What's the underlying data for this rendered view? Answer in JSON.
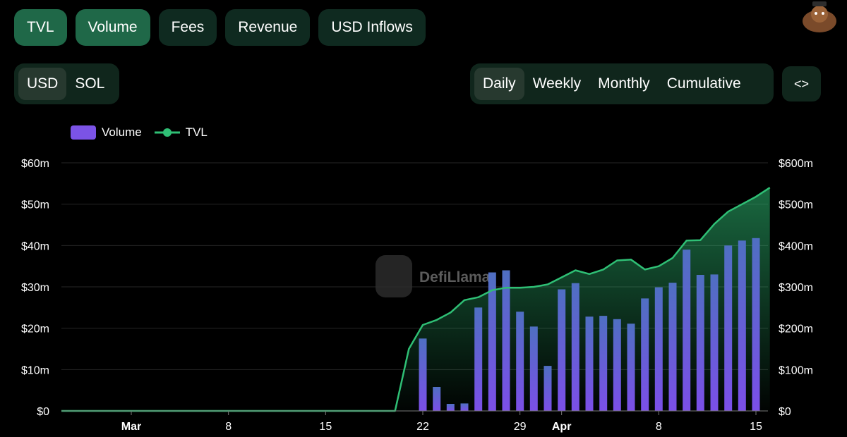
{
  "metric_tabs": [
    {
      "label": "TVL",
      "active": true
    },
    {
      "label": "Volume",
      "active": true
    },
    {
      "label": "Fees",
      "active": false
    },
    {
      "label": "Revenue",
      "active": false
    },
    {
      "label": "USD Inflows",
      "active": false
    }
  ],
  "currency_toggle": [
    {
      "label": "USD",
      "active": true
    },
    {
      "label": "SOL",
      "active": false
    }
  ],
  "period_toggle": [
    {
      "label": "Daily",
      "active": true
    },
    {
      "label": "Weekly",
      "active": false
    },
    {
      "label": "Monthly",
      "active": false
    },
    {
      "label": "Cumulative",
      "active": false
    }
  ],
  "embed_button": {
    "icon": "code-brackets-icon",
    "label": "<>"
  },
  "watermark": "DefiLlama",
  "colors": {
    "volume": "#7b53e6",
    "tvl": "#2fbf75",
    "active_pill": "#1f6848",
    "pill": "#0f2a20"
  },
  "chart_data": {
    "type": "bar",
    "legend": [
      {
        "name": "Volume",
        "kind": "bar"
      },
      {
        "name": "TVL",
        "kind": "line"
      }
    ],
    "x_ticks": [
      {
        "label": "Mar",
        "date": "Mar 1",
        "bold": true
      },
      {
        "label": "8",
        "date": "Mar 8",
        "bold": false
      },
      {
        "label": "15",
        "date": "Mar 15",
        "bold": false
      },
      {
        "label": "22",
        "date": "Mar 22",
        "bold": false
      },
      {
        "label": "29",
        "date": "Mar 29",
        "bold": false
      },
      {
        "label": "Apr",
        "date": "Apr 1",
        "bold": true
      },
      {
        "label": "8",
        "date": "Apr 8",
        "bold": false
      },
      {
        "label": "15",
        "date": "Apr 15",
        "bold": false
      }
    ],
    "y_left": {
      "ticks": [
        "$0",
        "$10m",
        "$20m",
        "$30m",
        "$40m",
        "$50m",
        "$60m"
      ],
      "range": [
        0,
        60
      ],
      "unit": "USD millions"
    },
    "y_right": {
      "ticks": [
        "$0",
        "$100m",
        "$200m",
        "$300m",
        "$400m",
        "$500m",
        "$600m"
      ],
      "range": [
        0,
        600
      ],
      "unit": "USD millions"
    },
    "grid": true,
    "series": [
      {
        "name": "Volume",
        "axis": "left",
        "points": [
          [
            "Mar 22",
            17.5
          ],
          [
            "Mar 23",
            5.8
          ],
          [
            "Mar 24",
            1.7
          ],
          [
            "Mar 25",
            1.8
          ],
          [
            "Mar 26",
            25
          ],
          [
            "Mar 27",
            33.5
          ],
          [
            "Mar 28",
            34
          ],
          [
            "Mar 29",
            24
          ],
          [
            "Mar 30",
            20.4
          ],
          [
            "Mar 31",
            10.9
          ],
          [
            "Apr 1",
            29.4
          ],
          [
            "Apr 2",
            30.9
          ],
          [
            "Apr 3",
            22.8
          ],
          [
            "Apr 4",
            23
          ],
          [
            "Apr 5",
            22.2
          ],
          [
            "Apr 6",
            21.1
          ],
          [
            "Apr 7",
            27.2
          ],
          [
            "Apr 8",
            29.9
          ],
          [
            "Apr 9",
            31
          ],
          [
            "Apr 10",
            39
          ],
          [
            "Apr 11",
            32.9
          ],
          [
            "Apr 12",
            33
          ],
          [
            "Apr 13",
            40
          ],
          [
            "Apr 14",
            41.2
          ],
          [
            "Apr 15",
            41.8
          ]
        ]
      },
      {
        "name": "TVL",
        "axis": "right",
        "points": [
          [
            "Feb 24",
            0
          ],
          [
            "Mar 20",
            0
          ],
          [
            "Mar 21",
            150
          ],
          [
            "Mar 22",
            208
          ],
          [
            "Mar 23",
            220
          ],
          [
            "Mar 24",
            238
          ],
          [
            "Mar 25",
            268
          ],
          [
            "Mar 26",
            275
          ],
          [
            "Mar 27",
            292
          ],
          [
            "Mar 28",
            298
          ],
          [
            "Mar 29",
            298
          ],
          [
            "Mar 30",
            300
          ],
          [
            "Mar 31",
            306
          ],
          [
            "Apr 1",
            323
          ],
          [
            "Apr 2",
            340
          ],
          [
            "Apr 3",
            331
          ],
          [
            "Apr 4",
            342
          ],
          [
            "Apr 5",
            364
          ],
          [
            "Apr 6",
            366
          ],
          [
            "Apr 7",
            342
          ],
          [
            "Apr 8",
            350
          ],
          [
            "Apr 9",
            370
          ],
          [
            "Apr 10",
            412
          ],
          [
            "Apr 11",
            413
          ],
          [
            "Apr 12",
            452
          ],
          [
            "Apr 13",
            482
          ],
          [
            "Apr 14",
            500
          ],
          [
            "Apr 15",
            518
          ],
          [
            "Apr 16",
            540
          ]
        ]
      }
    ]
  }
}
